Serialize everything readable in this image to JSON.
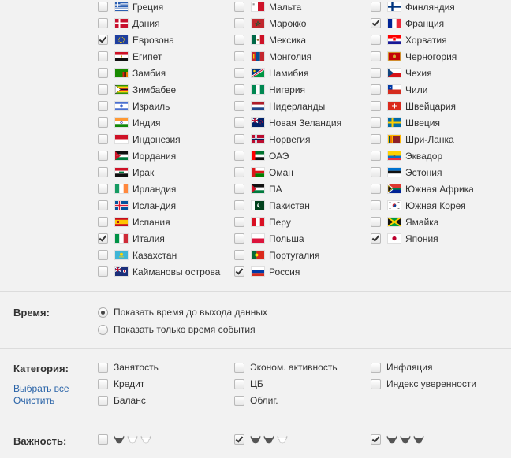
{
  "colors": {
    "background": "#f2f2f2",
    "text": "#333333",
    "link": "#2a64a8",
    "separator": "#dcdcdc"
  },
  "countries": {
    "col1": [
      {
        "label": "Греция",
        "checked": false,
        "flag": "greece-flag"
      },
      {
        "label": "Дания",
        "checked": false,
        "flag": "denmark-flag"
      },
      {
        "label": "Еврозона",
        "checked": true,
        "flag": "eurozone-flag"
      },
      {
        "label": "Египет",
        "checked": false,
        "flag": "egypt-flag"
      },
      {
        "label": "Замбия",
        "checked": false,
        "flag": "zambia-flag"
      },
      {
        "label": "Зимбабве",
        "checked": false,
        "flag": "zimbabwe-flag"
      },
      {
        "label": "Израиль",
        "checked": false,
        "flag": "israel-flag"
      },
      {
        "label": "Индия",
        "checked": false,
        "flag": "india-flag"
      },
      {
        "label": "Индонезия",
        "checked": false,
        "flag": "indonesia-flag"
      },
      {
        "label": "Иордания",
        "checked": false,
        "flag": "jordan-flag"
      },
      {
        "label": "Ирак",
        "checked": false,
        "flag": "iraq-flag"
      },
      {
        "label": "Ирландия",
        "checked": false,
        "flag": "ireland-flag"
      },
      {
        "label": "Исландия",
        "checked": false,
        "flag": "iceland-flag"
      },
      {
        "label": "Испания",
        "checked": false,
        "flag": "spain-flag"
      },
      {
        "label": "Италия",
        "checked": true,
        "flag": "italy-flag"
      },
      {
        "label": "Казахстан",
        "checked": false,
        "flag": "kazakhstan-flag"
      },
      {
        "label": "Каймановы острова",
        "checked": false,
        "flag": "cayman-islands-flag"
      }
    ],
    "col2": [
      {
        "label": "Мальта",
        "checked": false,
        "flag": "malta-flag"
      },
      {
        "label": "Марокко",
        "checked": false,
        "flag": "morocco-flag"
      },
      {
        "label": "Мексика",
        "checked": false,
        "flag": "mexico-flag"
      },
      {
        "label": "Монголия",
        "checked": false,
        "flag": "mongolia-flag"
      },
      {
        "label": "Намибия",
        "checked": false,
        "flag": "namibia-flag"
      },
      {
        "label": "Нигерия",
        "checked": false,
        "flag": "nigeria-flag"
      },
      {
        "label": "Нидерланды",
        "checked": false,
        "flag": "netherlands-flag"
      },
      {
        "label": "Новая Зеландия",
        "checked": false,
        "flag": "new-zealand-flag"
      },
      {
        "label": "Норвегия",
        "checked": false,
        "flag": "norway-flag"
      },
      {
        "label": "ОАЭ",
        "checked": false,
        "flag": "uae-flag"
      },
      {
        "label": "Оман",
        "checked": false,
        "flag": "oman-flag"
      },
      {
        "label": "ПА",
        "checked": false,
        "flag": "palestine-flag"
      },
      {
        "label": "Пакистан",
        "checked": false,
        "flag": "pakistan-flag"
      },
      {
        "label": "Перу",
        "checked": false,
        "flag": "peru-flag"
      },
      {
        "label": "Польша",
        "checked": false,
        "flag": "poland-flag"
      },
      {
        "label": "Португалия",
        "checked": false,
        "flag": "portugal-flag"
      },
      {
        "label": "Россия",
        "checked": true,
        "flag": "russia-flag"
      }
    ],
    "col3": [
      {
        "label": "Финляндия",
        "checked": false,
        "flag": "finland-flag"
      },
      {
        "label": "Франция",
        "checked": true,
        "flag": "france-flag"
      },
      {
        "label": "Хорватия",
        "checked": false,
        "flag": "croatia-flag"
      },
      {
        "label": "Черногория",
        "checked": false,
        "flag": "montenegro-flag"
      },
      {
        "label": "Чехия",
        "checked": false,
        "flag": "czech-flag"
      },
      {
        "label": "Чили",
        "checked": false,
        "flag": "chile-flag"
      },
      {
        "label": "Швейцария",
        "checked": false,
        "flag": "switzerland-flag"
      },
      {
        "label": "Швеция",
        "checked": false,
        "flag": "sweden-flag"
      },
      {
        "label": "Шри-Ланка",
        "checked": false,
        "flag": "sri-lanka-flag"
      },
      {
        "label": "Эквадор",
        "checked": false,
        "flag": "ecuador-flag"
      },
      {
        "label": "Эстония",
        "checked": false,
        "flag": "estonia-flag"
      },
      {
        "label": "Южная Африка",
        "checked": false,
        "flag": "south-africa-flag"
      },
      {
        "label": "Южная Корея",
        "checked": false,
        "flag": "south-korea-flag"
      },
      {
        "label": "Ямайка",
        "checked": false,
        "flag": "jamaica-flag"
      },
      {
        "label": "Япония",
        "checked": true,
        "flag": "japan-flag"
      }
    ]
  },
  "time": {
    "title": "Время:",
    "options": [
      {
        "label": "Показать время до выхода данных",
        "selected": true
      },
      {
        "label": "Показать только время события",
        "selected": false
      }
    ]
  },
  "category": {
    "title": "Категория:",
    "select_all": "Выбрать все",
    "clear": "Очистить",
    "col1": [
      {
        "label": "Занятость",
        "checked": false
      },
      {
        "label": "Кредит",
        "checked": false
      },
      {
        "label": "Баланс",
        "checked": false
      }
    ],
    "col2": [
      {
        "label": "Эконом. активность",
        "checked": false
      },
      {
        "label": "ЦБ",
        "checked": false
      },
      {
        "label": "Облиг.",
        "checked": false
      }
    ],
    "col3": [
      {
        "label": "Инфляция",
        "checked": false
      },
      {
        "label": "Индекс уверенности",
        "checked": false
      }
    ]
  },
  "importance": {
    "title": "Важность:",
    "levels": [
      {
        "level": 1,
        "of": 3,
        "checked": false,
        "icon": "bull-icon"
      },
      {
        "level": 2,
        "of": 3,
        "checked": true,
        "icon": "bull-icon"
      },
      {
        "level": 3,
        "of": 3,
        "checked": true,
        "icon": "bull-icon"
      }
    ]
  }
}
